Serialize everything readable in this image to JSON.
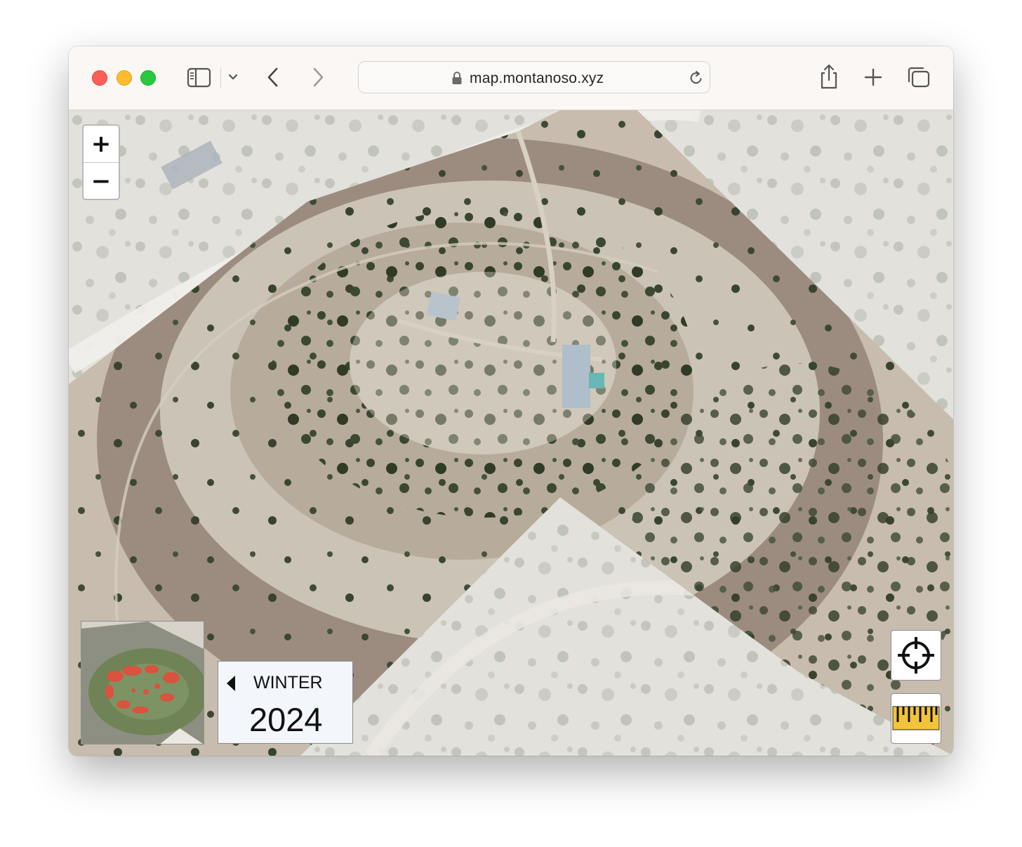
{
  "browser": {
    "url": "map.montanoso.xyz",
    "icons": {
      "sidebar": "sidebar-icon",
      "sidebar_menu": "chevron-down-icon",
      "back": "chevron-left-icon",
      "forward": "chevron-right-icon",
      "lock": "lock-icon",
      "reload": "reload-icon",
      "share": "share-icon",
      "new_tab": "plus-icon",
      "tab_overview": "tabs-icon"
    }
  },
  "map": {
    "zoom_in_label": "+",
    "zoom_out_label": "−",
    "season": {
      "label": "WINTER",
      "year": "2024"
    },
    "controls": {
      "locate": "crosshair-icon",
      "measure": "ruler-icon"
    },
    "colors": {
      "ruler_yellow": "#f3c43a",
      "minimap_highlight": "#d9533e"
    }
  }
}
